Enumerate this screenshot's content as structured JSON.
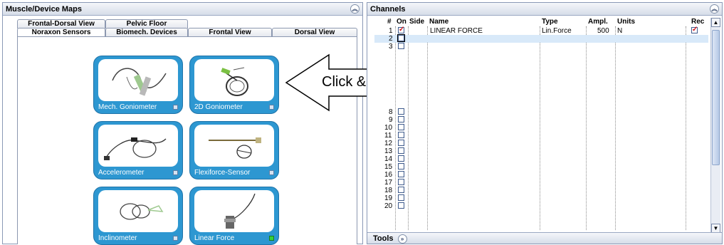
{
  "left_panel": {
    "title": "Muscle/Device Maps",
    "collapse_icon": "double-chevron-up-icon",
    "tabs_row1": [
      "Frontal-Dorsal View",
      "Pelvic Floor"
    ],
    "tabs_row2": [
      "Noraxon Sensors",
      "Biomech. Devices",
      "Frontal View",
      "Dorsal View"
    ],
    "active_tab": "Noraxon Sensors",
    "sensors": [
      {
        "label": "Mech. Goniometer",
        "active": false
      },
      {
        "label": "2D Goniometer",
        "active": false
      },
      {
        "label": "Accelerometer",
        "active": false
      },
      {
        "label": "Flexiforce-Sensor",
        "active": false
      },
      {
        "label": "Inclinometer",
        "active": false
      },
      {
        "label": "Linear Force",
        "active": true
      }
    ]
  },
  "callout": {
    "text": "Click & Select"
  },
  "right_panel": {
    "title": "Channels",
    "collapse_icon": "double-chevron-up-icon",
    "columns": [
      "#",
      "On",
      "Side",
      "Name",
      "Type",
      "Ampl.",
      "Units",
      "Rec"
    ],
    "rows": [
      {
        "num": "1",
        "on": true,
        "name": "LINEAR FORCE",
        "type": "Lin.Force",
        "ampl": "500",
        "units": "N",
        "rec": true
      },
      {
        "num": "2",
        "on": false,
        "selected": true
      },
      {
        "num": "3",
        "on": false
      },
      {
        "num": "8",
        "on": false
      },
      {
        "num": "9",
        "on": false
      },
      {
        "num": "10",
        "on": false
      },
      {
        "num": "11",
        "on": false
      },
      {
        "num": "12",
        "on": false
      },
      {
        "num": "13",
        "on": false
      },
      {
        "num": "14",
        "on": false
      },
      {
        "num": "15",
        "on": false
      },
      {
        "num": "16",
        "on": false
      },
      {
        "num": "17",
        "on": false
      },
      {
        "num": "18",
        "on": false
      },
      {
        "num": "19",
        "on": false
      },
      {
        "num": "20",
        "on": false
      }
    ],
    "tools_label": "Tools",
    "tools_icon": "double-chevron-right-icon"
  }
}
